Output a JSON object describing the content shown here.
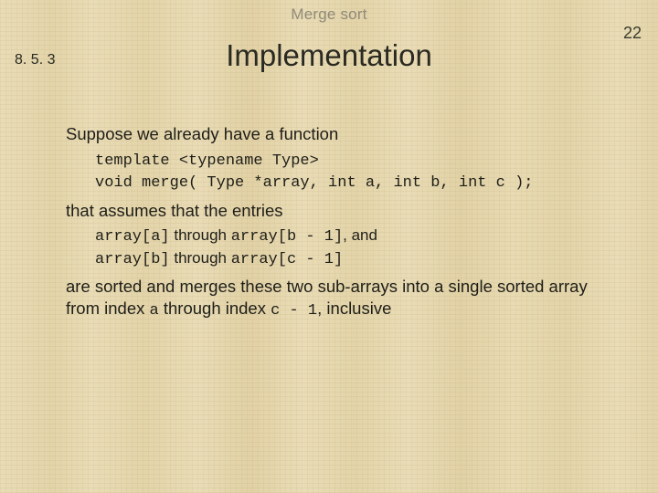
{
  "header": "Merge sort",
  "page_number": "22",
  "section_number": "8. 5. 3",
  "title": "Implementation",
  "body": {
    "p1": "Suppose we already have a function",
    "code1_line1": "template <typename Type>",
    "code1_line2": "void merge( Type *array, int a, int b, int c );",
    "p2": "that assumes that the entries",
    "line2a_code1": "array[a]",
    "line2a_mid": " through ",
    "line2a_code2": "array[b - 1]",
    "line2a_tail": ", and",
    "line2b_code1": "array[b]",
    "line2b_mid": " through ",
    "line2b_code2": "array[c - 1]",
    "p3a": "are sorted and merges these two sub-arrays into a single sorted array from index ",
    "p3_code1": "a",
    "p3b": " through index ",
    "p3_code2": "c - 1",
    "p3c": ", inclusive"
  }
}
